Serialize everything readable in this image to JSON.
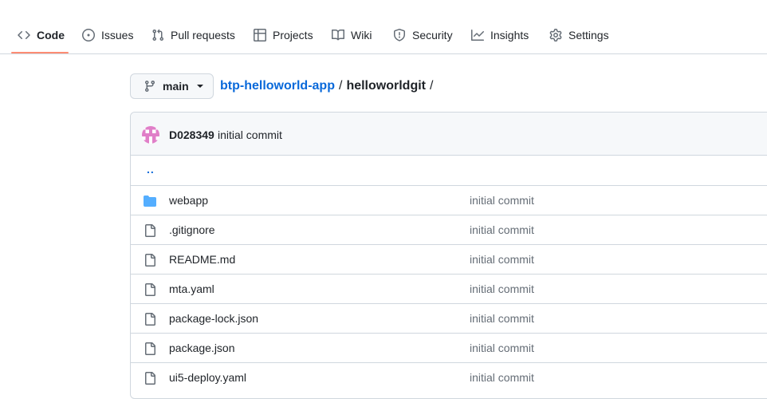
{
  "nav": {
    "tabs": [
      {
        "label": "Code",
        "icon": "code-icon",
        "selected": true
      },
      {
        "label": "Issues",
        "icon": "issue-opened-icon"
      },
      {
        "label": "Pull requests",
        "icon": "git-pull-request-icon"
      },
      {
        "label": "Projects",
        "icon": "table-icon"
      },
      {
        "label": "Wiki",
        "icon": "book-icon"
      },
      {
        "label": "Security",
        "icon": "shield-icon"
      },
      {
        "label": "Insights",
        "icon": "graph-icon"
      },
      {
        "label": "Settings",
        "icon": "gear-icon"
      }
    ],
    "underline_color": "#fd8c73"
  },
  "branch": {
    "name": "main",
    "icon": "git-branch-icon"
  },
  "breadcrumb": {
    "repo": "btp-helloworld-app",
    "separator": "/",
    "folder": "helloworldgit",
    "trailing": "/"
  },
  "latest_commit": {
    "author": "D028349",
    "message": "initial commit",
    "avatar_color": "#e07fc8"
  },
  "parent_link": "..",
  "files": [
    {
      "name": "webapp",
      "type": "directory",
      "icon": "folder-icon",
      "commit": "initial commit"
    },
    {
      "name": ".gitignore",
      "type": "file",
      "icon": "file-icon",
      "commit": "initial commit"
    },
    {
      "name": "README.md",
      "type": "file",
      "icon": "file-icon",
      "commit": "initial commit"
    },
    {
      "name": "mta.yaml",
      "type": "file",
      "icon": "file-icon",
      "commit": "initial commit"
    },
    {
      "name": "package-lock.json",
      "type": "file",
      "icon": "file-icon",
      "commit": "initial commit"
    },
    {
      "name": "package.json",
      "type": "file",
      "icon": "file-icon",
      "commit": "initial commit"
    },
    {
      "name": "ui5-deploy.yaml",
      "type": "file",
      "icon": "file-icon",
      "commit": "initial commit"
    }
  ],
  "colors": {
    "link": "#0969da",
    "folder": "#54aeff",
    "border": "#d0d7de",
    "muted": "#656d76"
  }
}
